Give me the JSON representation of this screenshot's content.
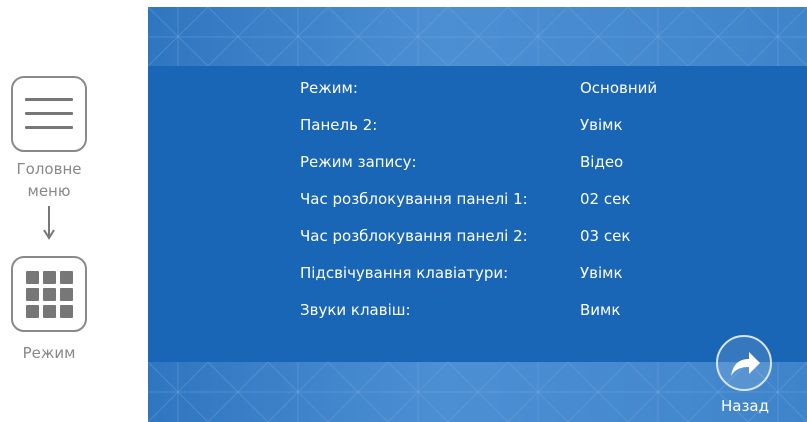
{
  "nav": {
    "main_menu_label_line1": "Головне",
    "main_menu_label_line2": "меню",
    "mode_label": "Режим"
  },
  "settings": [
    {
      "label": "Режим:",
      "value": "Основний"
    },
    {
      "label": "Панель 2:",
      "value": "Увімк"
    },
    {
      "label": "Режим запису:",
      "value": "Відео"
    },
    {
      "label": "Час розблокування панелі 1:",
      "value": "02 сек"
    },
    {
      "label": "Час розблокування панелі 2:",
      "value": "03 сек"
    },
    {
      "label": "Підсвічування клавіатури:",
      "value": "Увімк"
    },
    {
      "label": "Звуки клавіш:",
      "value": "Вимк"
    }
  ],
  "back_button": {
    "label": "Назад",
    "icon": "forward-arrow-icon"
  },
  "colors": {
    "screen_bg": "#1a66b6",
    "band": "#4d8fd3",
    "text": "#ffffff",
    "nav_gray": "#888888"
  }
}
